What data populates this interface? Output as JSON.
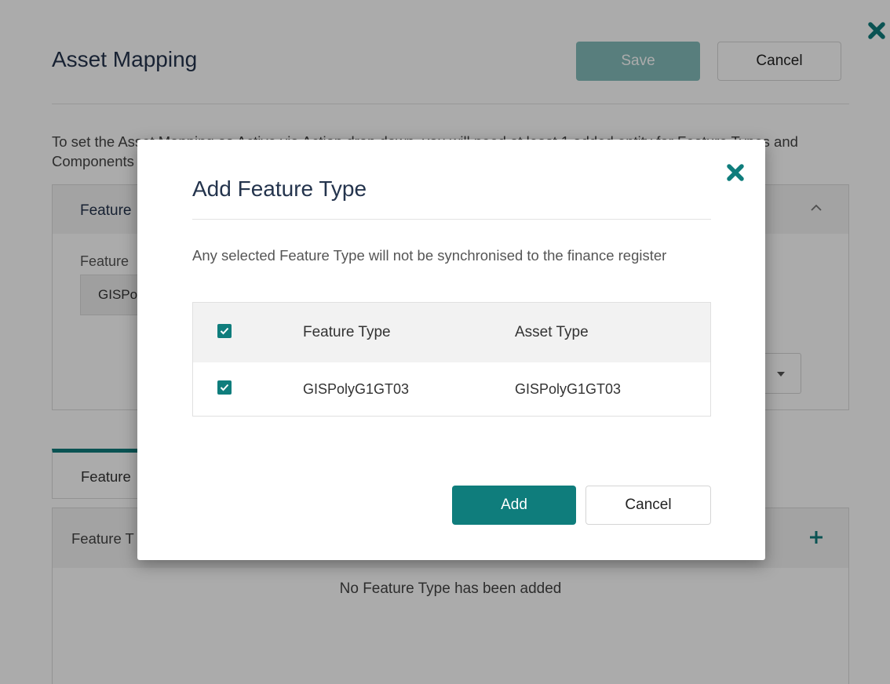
{
  "page": {
    "title": "Asset Mapping",
    "save_label": "Save",
    "cancel_label": "Cancel",
    "info_text": "To set the Asset Mapping as Active via Action drop down, you will need at least 1 added entity for Feature Types and Components",
    "details": {
      "title": "Feature",
      "field_label": "Feature",
      "field_value": "GISPo"
    },
    "tab_label": "Feature",
    "list": {
      "header_label": "Feature T",
      "empty_text": "No Feature Type has been added"
    }
  },
  "modal": {
    "title": "Add Feature Type",
    "notice": "Any selected Feature Type will not be synchronised to the finance register",
    "columns": {
      "feature_type": "Feature Type",
      "asset_type": "Asset Type"
    },
    "rows": [
      {
        "feature_type": "GISPolyG1GT03",
        "asset_type": "GISPolyG1GT03",
        "checked": true
      }
    ],
    "add_label": "Add",
    "cancel_label": "Cancel"
  },
  "colors": {
    "accent": "#0f7d7c",
    "heading": "#24344d"
  },
  "icons": {
    "close": "close-x-icon",
    "checkbox": "checkbox-checked-icon",
    "collapse": "chevron-up-icon",
    "add": "plus-icon",
    "dropdown": "caret-down-icon"
  }
}
